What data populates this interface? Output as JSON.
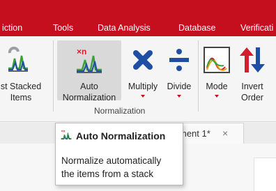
{
  "menubar": {
    "items": [
      "iction",
      "Tools",
      "Data Analysis",
      "Database",
      "Verificati"
    ]
  },
  "ribbon": {
    "buttons": {
      "stacked": {
        "line1": "st Stacked",
        "line2": "Items"
      },
      "auto_norm": {
        "line1": "Auto",
        "line2": "Normalization"
      },
      "multiply": {
        "line1": "Multiply"
      },
      "divide": {
        "line1": "Divide"
      },
      "mode": {
        "line1": "Mode"
      },
      "invert": {
        "line1": "Invert",
        "line2": "Order"
      }
    },
    "group_label": "Normalization"
  },
  "document_tab": {
    "title": "ment 1*",
    "close": "×"
  },
  "tooltip": {
    "title": "Auto Normalization",
    "body_line1": "Normalize automatically",
    "body_line2": "the items from a stack"
  },
  "colors": {
    "menubar": "#c50f1f",
    "accent_blue": "#1f4fa3",
    "accent_red": "#d21f2b",
    "accent_green": "#3aa13a"
  }
}
